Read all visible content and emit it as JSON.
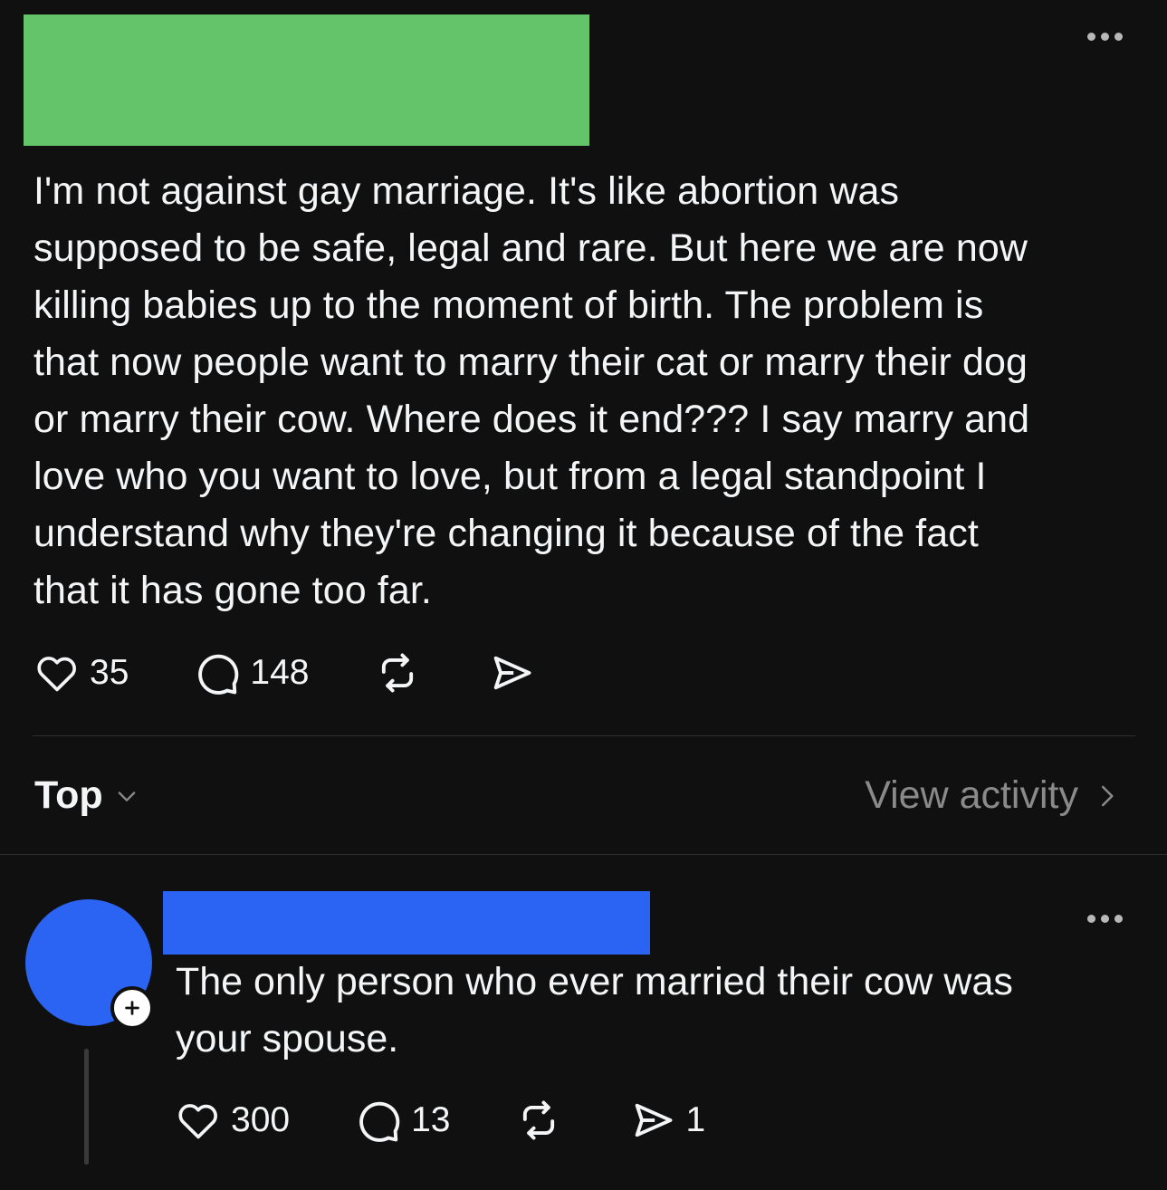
{
  "post": {
    "text": "I'm not against gay marriage. It's like abortion was\nsupposed to be safe, legal and rare. But here we are now\nkilling babies up to the moment of birth. The problem is\nthat now people want to marry their cat or marry their dog\nor marry their cow. Where does it end??? I say marry and\nlove who you want to love, but from a legal standpoint I\nunderstand why they're changing it because of the fact\nthat it has gone too far.",
    "likes": "35",
    "comments": "148"
  },
  "sort": {
    "label": "Top"
  },
  "view_activity": {
    "label": "View activity"
  },
  "reply": {
    "text": "The only person who ever married their cow was\nyour spouse.",
    "likes": "300",
    "comments": "13",
    "shares": "1"
  },
  "colors": {
    "background": "#101010",
    "text": "#f3f5f7",
    "muted": "#8a8a8a",
    "redaction_green": "#64c46a",
    "redaction_blue": "#2b63f2"
  },
  "icons": [
    "more-icon",
    "heart-icon",
    "comment-icon",
    "repost-icon",
    "share-icon",
    "chevron-down-icon",
    "chevron-right-icon",
    "follow-plus-icon"
  ]
}
